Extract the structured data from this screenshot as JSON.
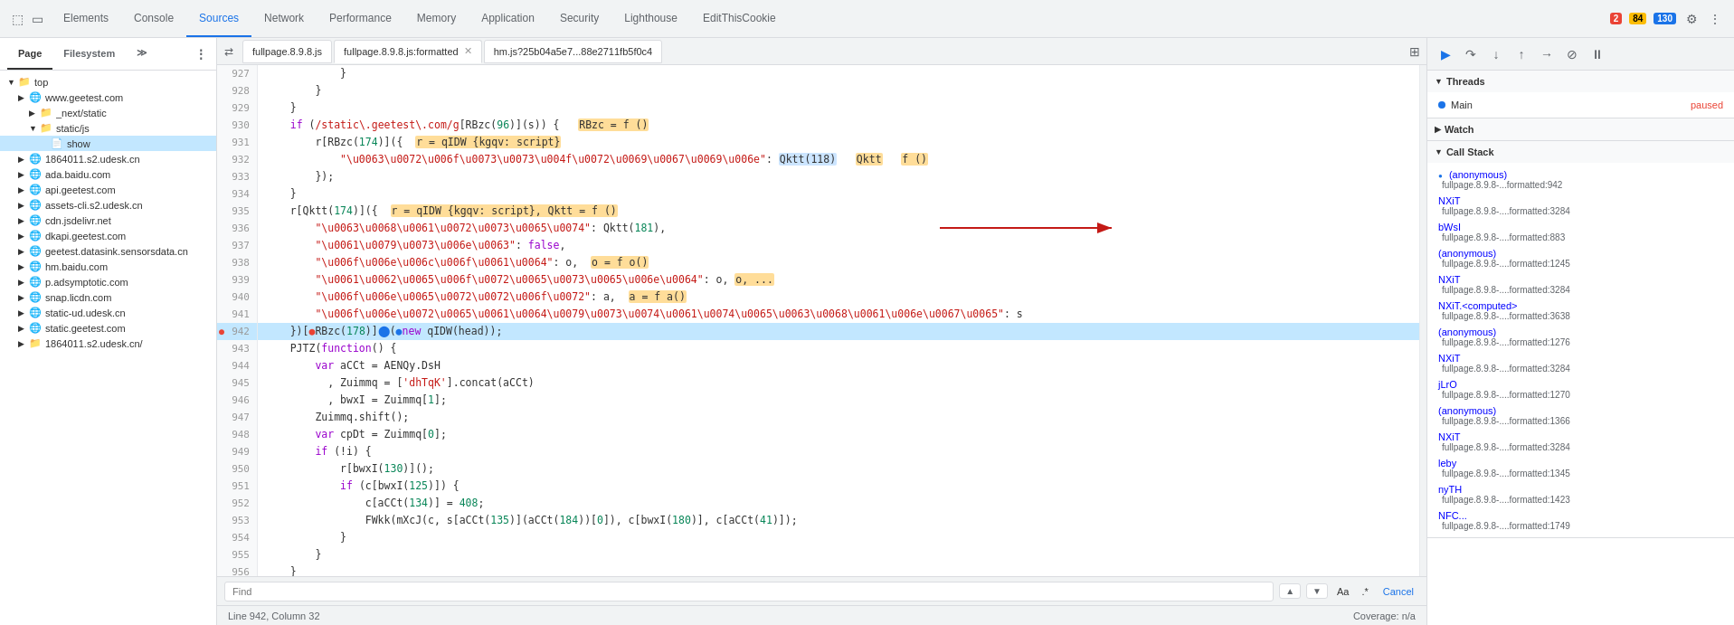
{
  "toolbar": {
    "icons": [
      "cursor",
      "box"
    ],
    "tabs": [
      {
        "label": "Elements",
        "active": false
      },
      {
        "label": "Console",
        "active": false
      },
      {
        "label": "Sources",
        "active": true
      },
      {
        "label": "Network",
        "active": false
      },
      {
        "label": "Performance",
        "active": false
      },
      {
        "label": "Memory",
        "active": false
      },
      {
        "label": "Application",
        "active": false
      },
      {
        "label": "Security",
        "active": false
      },
      {
        "label": "Lighthouse",
        "active": false
      },
      {
        "label": "EditThisCookie",
        "active": false
      }
    ],
    "badges": {
      "errors": "2",
      "warnings": "84",
      "info": "130"
    }
  },
  "sidebar": {
    "header": "Page",
    "tabs": [
      {
        "label": "Page",
        "active": true
      },
      {
        "label": "Filesystem",
        "active": false
      }
    ],
    "tree": [
      {
        "id": "top",
        "label": "top",
        "depth": 0,
        "type": "folder",
        "expanded": true
      },
      {
        "id": "www-geetest",
        "label": "www.geetest.com",
        "depth": 1,
        "type": "globe",
        "expanded": false
      },
      {
        "id": "next-static",
        "label": "_next/static",
        "depth": 2,
        "type": "folder",
        "expanded": false
      },
      {
        "id": "static-js",
        "label": "static/js",
        "depth": 2,
        "type": "folder",
        "expanded": false
      },
      {
        "id": "show",
        "label": "show",
        "depth": 3,
        "type": "file",
        "selected": true
      },
      {
        "id": "1864011-s2-udesk",
        "label": "1864011.s2.udesk.cn",
        "depth": 1,
        "type": "globe",
        "expanded": false
      },
      {
        "id": "ada-baidu",
        "label": "ada.baidu.com",
        "depth": 1,
        "type": "globe",
        "expanded": false
      },
      {
        "id": "api-geetest",
        "label": "api.geetest.com",
        "depth": 1,
        "type": "globe",
        "expanded": false
      },
      {
        "id": "assets-cli-s2-udesk",
        "label": "assets-cli.s2.udesk.cn",
        "depth": 1,
        "type": "globe",
        "expanded": false
      },
      {
        "id": "cdn-jsdelivr",
        "label": "cdn.jsdelivr.net",
        "depth": 1,
        "type": "globe",
        "expanded": false
      },
      {
        "id": "dkapi-geetest",
        "label": "dkapi.geetest.com",
        "depth": 1,
        "type": "globe",
        "expanded": false
      },
      {
        "id": "geetest-datasink",
        "label": "geetest.datasink.sensorsdata.cn",
        "depth": 1,
        "type": "globe",
        "expanded": false
      },
      {
        "id": "hm-baidu",
        "label": "hm.baidu.com",
        "depth": 1,
        "type": "globe",
        "expanded": false
      },
      {
        "id": "p-adsymptotic",
        "label": "p.adsymptotic.com",
        "depth": 1,
        "type": "globe",
        "expanded": false
      },
      {
        "id": "snap-licdn",
        "label": "snap.licdn.com",
        "depth": 1,
        "type": "globe",
        "expanded": false
      },
      {
        "id": "static-ud-udesk",
        "label": "static-ud.udesk.cn",
        "depth": 1,
        "type": "globe",
        "expanded": false
      },
      {
        "id": "static-geetest",
        "label": "static.geetest.com",
        "depth": 1,
        "type": "globe",
        "expanded": false
      },
      {
        "id": "1864011-s2-udesk2",
        "label": "1864011.s2.udesk.cn/",
        "depth": 1,
        "type": "folder",
        "expanded": false
      }
    ]
  },
  "file_tabs": [
    {
      "label": "fullpage.8.9.8.js",
      "active": false,
      "closeable": false
    },
    {
      "label": "fullpage.8.9.8.js:formatted",
      "active": true,
      "closeable": true
    },
    {
      "label": "hm.js?25b04a5e7...88e2711fb5f0c4",
      "active": false,
      "closeable": false
    }
  ],
  "code_lines": [
    {
      "num": 927,
      "code": "            }"
    },
    {
      "num": 928,
      "code": "        }"
    },
    {
      "num": 929,
      "code": "    }"
    },
    {
      "num": 930,
      "code": "    if (/static\\.geetest\\.com/g[RBzc(96)](s)) {   RBzc = f ()"
    },
    {
      "num": 931,
      "code": "        r[RBzc(174)]({  r = qIDW {kgqv: script}"
    },
    {
      "num": 932,
      "code": "            \"\\u0063\\u0072\\u006f\\u0073\\u0073\\u004f\\u0072\\u0069\\u0067\\u0069\\u006e\": Qktt(118)   Qktt   f ()"
    },
    {
      "num": 933,
      "code": "        });"
    },
    {
      "num": 934,
      "code": "    }"
    },
    {
      "num": 935,
      "code": "    r[Qktt(174)]({  r = qIDW {kgqv: script}, Qktt = f ()"
    },
    {
      "num": 936,
      "code": "        \"\\u0063\\u0068\\u0061\\u0072\\u0073\\u0065\\u0074\": Qktt(181),"
    },
    {
      "num": 937,
      "code": "        \"\\u0061\\u0079\\u0073\\u006e\\u0063\": false,"
    },
    {
      "num": 938,
      "code": "        \"\\u006f\\u006e\\u006c\\u006f\\u0061\\u0064\": o,   o = f o()"
    },
    {
      "num": 939,
      "code": "        \"\\u0061\\u0062\\u0065\\u006f\\u0072\\u0065\\u0073\\u0065\\u006e\\u0064\": o, ..."
    },
    {
      "num": 940,
      "code": "        \"\\u006f\\u006e\\u0065\\u0072\\u0072\\u006f\\u0072\": a,   a = f a()"
    },
    {
      "num": 941,
      "code": "        \"\\u006f\\u006e\\u0072\\u0065\\u0061\\u0064\\u0079\\u0073\\u0074\\u0061\\u0074\\u0065\\u0063\\u0068\\u0061\\u006e\\u0067\\u0065\": s"
    },
    {
      "num": 942,
      "code": "    })[●RBzc(178)]⬤(●new qIDW(head));",
      "highlighted": true,
      "breakpoint": true
    },
    {
      "num": 943,
      "code": "    PJTZ(function() {"
    },
    {
      "num": 944,
      "code": "        var aCCt = AENQy.DsH"
    },
    {
      "num": 945,
      "code": "          , Zuimmq = ['dhTqK'].concat(aCCt)"
    },
    {
      "num": 946,
      "code": "          , bwxI = Zuimmq[1];"
    },
    {
      "num": 947,
      "code": "        Zuimmq.shift();"
    },
    {
      "num": 948,
      "code": "        var cpDt = Zuimmq[0];"
    },
    {
      "num": 949,
      "code": "        if (!i) {"
    },
    {
      "num": 950,
      "code": "            r[bwxI(130)]();"
    },
    {
      "num": 951,
      "code": "            if (c[bwxI(125)]) {"
    },
    {
      "num": 952,
      "code": "                c[aCCt(134)] = 408;"
    },
    {
      "num": 953,
      "code": "                FWkk(mXcJ(c, s[aCCt(135)](aCCt(184))[0]), c[bwxI(180)], c[aCCt(41)]);"
    },
    {
      "num": 954,
      "code": "            }"
    },
    {
      "num": 955,
      "code": "        }"
    },
    {
      "num": 956,
      "code": "    }"
    }
  ],
  "right_panel": {
    "debug_buttons": [
      "resume",
      "step-over",
      "step-into",
      "step-out",
      "step",
      "deactivate",
      "pause-on-exception"
    ],
    "threads": {
      "label": "Threads",
      "items": [
        {
          "label": "Main",
          "status": "paused"
        }
      ]
    },
    "watch": {
      "label": "Watch",
      "collapsed": true
    },
    "call_stack": {
      "label": "Call Stack",
      "items": [
        {
          "fn": "(anonymous)",
          "loc": "fullpage.8.9.8-...formatted:942"
        },
        {
          "fn": "NXiT",
          "loc": "fullpage.8.9.8-....formatted:3284"
        },
        {
          "fn": "bWsI",
          "loc": "fullpage.8.9.8-....formatted:883"
        },
        {
          "fn": "(anonymous)",
          "loc": "fullpage.8.9.8-....formatted:1245"
        },
        {
          "fn": "NXiT",
          "loc": "fullpage.8.9.8-....formatted:3284"
        },
        {
          "fn": "NXiT.<computed>",
          "loc": "fullpage.8.9.8-....formatted:3638"
        },
        {
          "fn": "(anonymous)",
          "loc": "fullpage.8.9.8-....formatted:1276"
        },
        {
          "fn": "NXiT",
          "loc": "fullpage.8.9.8-....formatted:3284"
        },
        {
          "fn": "jLrO",
          "loc": "fullpage.8.9.8-....formatted:1270"
        },
        {
          "fn": "(anonymous)",
          "loc": "fullpage.8.9.8-....formatted:1366"
        },
        {
          "fn": "NXiT",
          "loc": "fullpage.8.9.8-....formatted:3284"
        },
        {
          "fn": "leby",
          "loc": "fullpage.8.9.8-....formatted:1345"
        },
        {
          "fn": "nyTH",
          "loc": "fullpage.8.9.8-....formatted:1423"
        },
        {
          "fn": "NFC...",
          "loc": "fullpage.8.9.8-....formatted:1749"
        }
      ]
    }
  },
  "find_bar": {
    "placeholder": "Find",
    "case_sensitive_label": "Aa",
    "regex_label": ".*",
    "cancel_label": "Cancel"
  },
  "status_bar": {
    "position": "Line 942, Column 32",
    "coverage": "Coverage: n/a"
  }
}
